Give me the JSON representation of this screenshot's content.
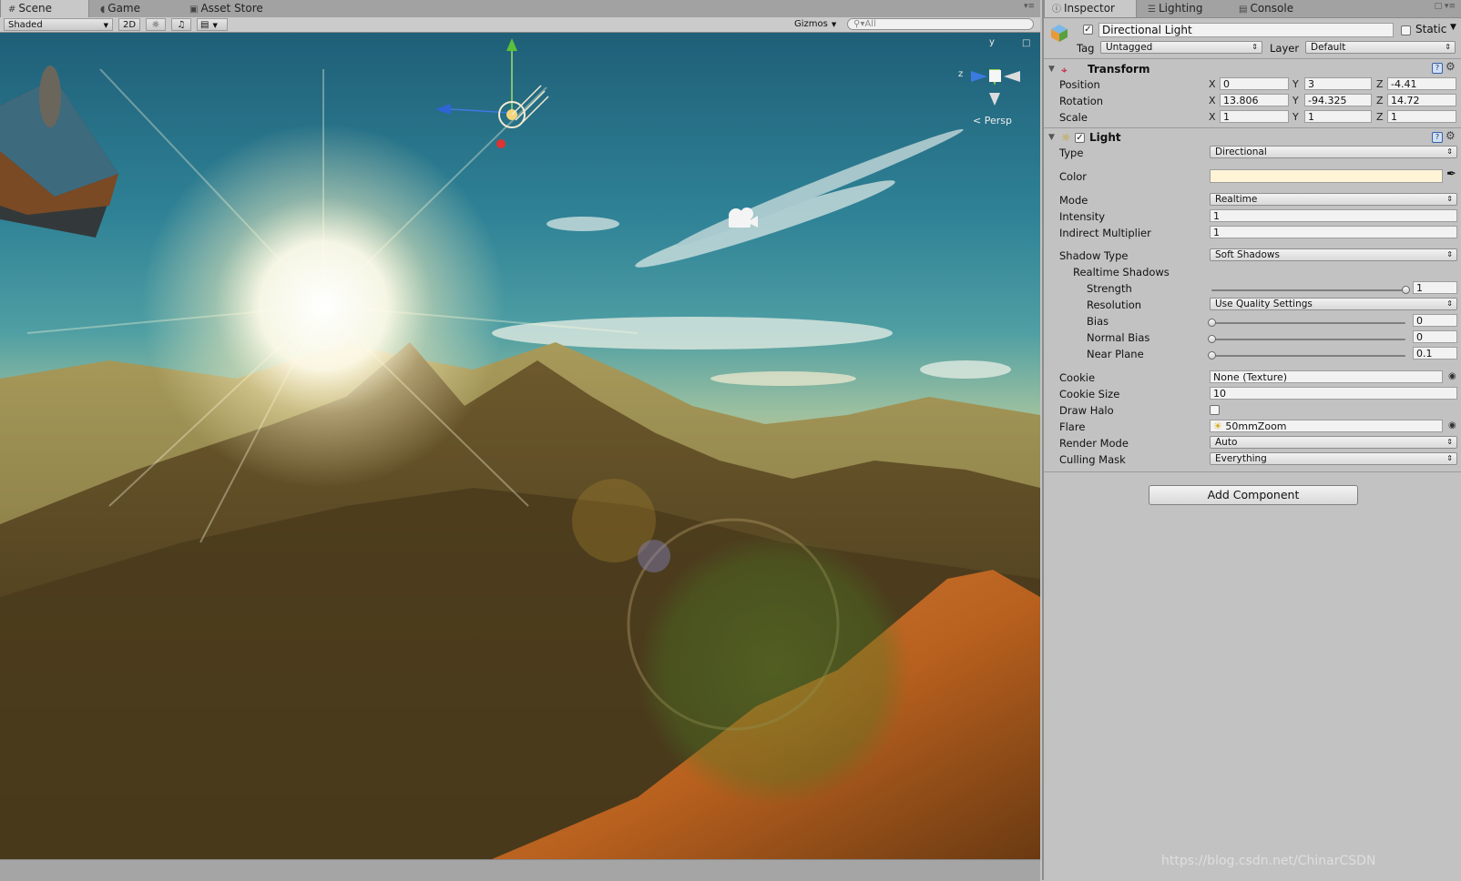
{
  "scene_panel": {
    "tabs": [
      {
        "label": "Scene",
        "icon": "grid-icon",
        "active": true
      },
      {
        "label": "Game",
        "icon": "pacman-icon",
        "active": false
      },
      {
        "label": "Asset Store",
        "icon": "store-icon",
        "active": false
      }
    ],
    "toolbar": {
      "draw_mode": "Shaded",
      "two_d": "2D",
      "gizmos": "Gizmos",
      "search_placeholder": "All"
    },
    "view": {
      "projection_label": "Persp",
      "axis_y": "y",
      "axis_z": "z"
    },
    "watermark": "https://blog.csdn.net/ChinarCSDN"
  },
  "inspector": {
    "tabs": [
      {
        "label": "Inspector",
        "icon": "info-icon",
        "active": true
      },
      {
        "label": "Lighting",
        "icon": "lighting-icon",
        "active": false
      },
      {
        "label": "Console",
        "icon": "console-icon",
        "active": false
      }
    ],
    "object": {
      "name": "Directional Light",
      "enabled": true,
      "static_label": "Static",
      "tag_label": "Tag",
      "tag_value": "Untagged",
      "layer_label": "Layer",
      "layer_value": "Default"
    },
    "transform": {
      "title": "Transform",
      "rows": [
        {
          "label": "Position",
          "x": "0",
          "y": "3",
          "z": "-4.41"
        },
        {
          "label": "Rotation",
          "x": "13.806",
          "y": "-94.325",
          "z": "14.72"
        },
        {
          "label": "Scale",
          "x": "1",
          "y": "1",
          "z": "1"
        }
      ]
    },
    "light": {
      "title": "Light",
      "enabled": true,
      "type_label": "Type",
      "type_value": "Directional",
      "color_label": "Color",
      "color_value": "#fff4d6",
      "mode_label": "Mode",
      "mode_value": "Realtime",
      "intensity_label": "Intensity",
      "intensity_value": "1",
      "indirect_label": "Indirect Multiplier",
      "indirect_value": "1",
      "shadow_type_label": "Shadow Type",
      "shadow_type_value": "Soft Shadows",
      "realtime_shadows_label": "Realtime Shadows",
      "strength_label": "Strength",
      "strength_value": "1",
      "strength_level": 1.0,
      "resolution_label": "Resolution",
      "resolution_value": "Use Quality Settings",
      "bias_label": "Bias",
      "bias_value": "0",
      "bias_level": 0.0,
      "normal_bias_label": "Normal Bias",
      "normal_bias_value": "0",
      "normal_bias_level": 0.0,
      "near_plane_label": "Near Plane",
      "near_plane_value": "0.1",
      "near_plane_level": 0.0,
      "cookie_label": "Cookie",
      "cookie_value": "None (Texture)",
      "cookie_size_label": "Cookie Size",
      "cookie_size_value": "10",
      "draw_halo_label": "Draw Halo",
      "draw_halo_checked": false,
      "flare_label": "Flare",
      "flare_value": "50mmZoom",
      "render_mode_label": "Render Mode",
      "render_mode_value": "Auto",
      "culling_mask_label": "Culling Mask",
      "culling_mask_value": "Everything"
    },
    "add_component": "Add Component"
  }
}
